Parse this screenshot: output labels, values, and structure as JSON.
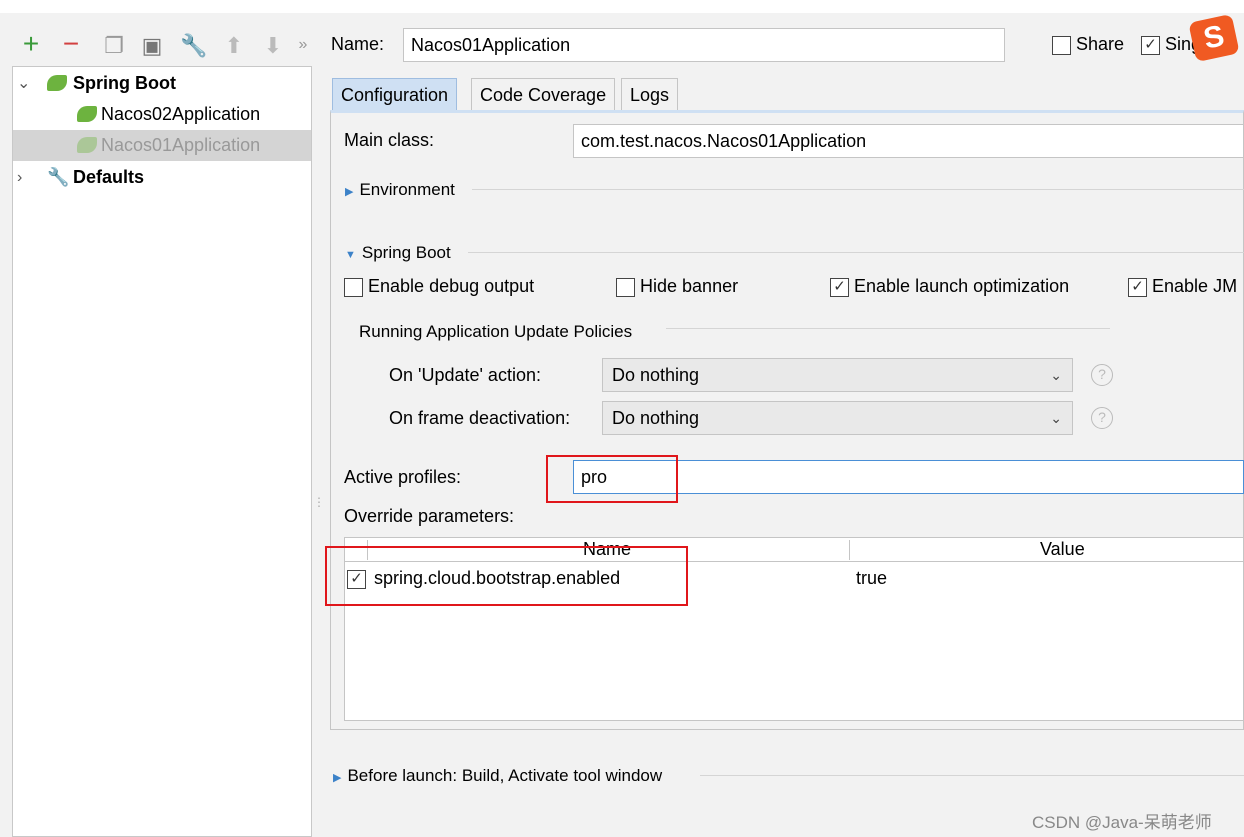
{
  "toolbar": {
    "more": "»"
  },
  "tree": {
    "groups": [
      {
        "label": "Spring Boot",
        "expanded": true,
        "children": [
          {
            "label": "Nacos02Application",
            "selected": false
          },
          {
            "label": "Nacos01Application",
            "selected": true
          }
        ]
      },
      {
        "label": "Defaults",
        "expanded": false
      }
    ]
  },
  "header": {
    "name_label": "Name:",
    "name_value": "Nacos01Application",
    "share_label": "Share",
    "share_checked": false,
    "single_label": "Sing",
    "single_checked": true
  },
  "tabs": [
    {
      "label": "Configuration",
      "active": true
    },
    {
      "label": "Code Coverage"
    },
    {
      "label": "Logs"
    }
  ],
  "config": {
    "main_class_label": "Main class:",
    "main_class_value": "com.test.nacos.Nacos01Application",
    "environment_label": "Environment",
    "spring_boot_label": "Spring Boot",
    "options": [
      {
        "label": "Enable debug output",
        "checked": false
      },
      {
        "label": "Hide banner",
        "checked": false
      },
      {
        "label": "Enable launch optimization",
        "checked": true
      },
      {
        "label": "Enable JM",
        "checked": true
      }
    ],
    "policies_label": "Running Application Update Policies",
    "update_action_label": "On 'Update' action:",
    "update_action_value": "Do nothing",
    "frame_deactivation_label": "On frame deactivation:",
    "frame_deactivation_value": "Do nothing",
    "active_profiles_label": "Active profiles:",
    "active_profiles_value": "pro",
    "override_label": "Override parameters:",
    "table": {
      "columns": [
        "Name",
        "Value"
      ],
      "rows": [
        {
          "checked": true,
          "name": "spring.cloud.bootstrap.enabled",
          "value": "true"
        }
      ]
    }
  },
  "before_launch": "Before launch: Build, Activate tool window",
  "watermark": "CSDN @Java-呆萌老师",
  "colors": {
    "highlight": "#e0161b",
    "spring": "#6db33f",
    "tab_active": "#cfe0f3"
  }
}
